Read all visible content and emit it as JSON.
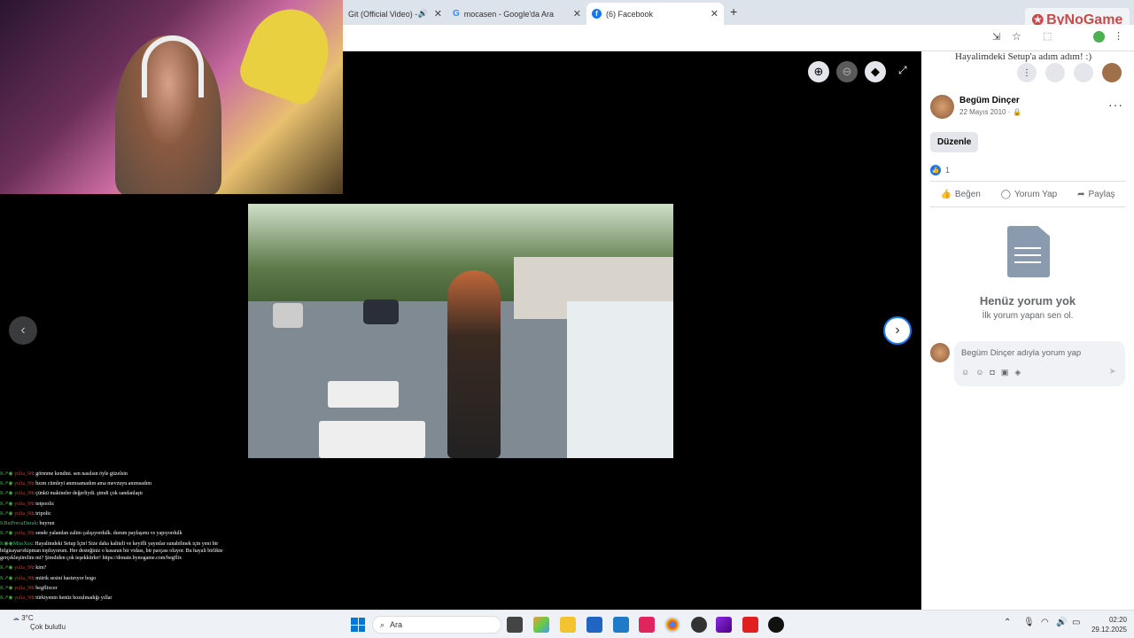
{
  "browser": {
    "tabs": [
      {
        "label": "Git (Official Video) -",
        "active": false
      },
      {
        "label": "mocasen - Google'da Ara",
        "active": false
      },
      {
        "label": "(6) Facebook",
        "active": true
      }
    ],
    "new_tab": "+"
  },
  "overlay": {
    "logo": "ByNoGame",
    "banner": "Hayalimdeki Setup'a adım adım! :)"
  },
  "post": {
    "author": "Begüm Dinçer",
    "date": "22 Mayıs 2010 ·",
    "edit_button": "Düzenle",
    "reaction_count": "1",
    "like_label": "Beğen",
    "comment_label": "Yorum Yap",
    "share_label": "Paylaş",
    "empty_title": "Henüz yorum yok",
    "empty_subtitle": "İlk yorum yapan sen ol.",
    "comment_placeholder": "Begüm Dinçer adıyla yorum yap"
  },
  "chat": [
    {
      "nick": "yulia_98",
      "msg": "görmme kendini. sen nasılsın öyle güzelsin"
    },
    {
      "nick": "yulia_98",
      "msg": "bzım cümleyi anımsamadım ama mevzuyu anımsadım"
    },
    {
      "nick": "yulia_98",
      "msg": "çünkü makineler değerliydi. şimdi çok sandanlaştı"
    },
    {
      "nick": "yulia_98",
      "msg": "teipoolic"
    },
    {
      "nick": "yulia_98",
      "msg": "tripolic"
    },
    {
      "nick": "BizPorcaDurak",
      "msg": "buyrun",
      "green": true
    },
    {
      "nick": "yulia_98",
      "msg": "sende yalandan zalim çalışıyordulk. durum paylaşımı vs yapıyordulk"
    },
    {
      "nick": "MissXsx",
      "msg": "Hayalimdeki Setup İçin! Size daha kaliteli ve keyifli yayınlar sunabilmek için yeni bir bilgisayar/ekipman topluyorum. Her desteğiniz o kasanın bir vidası, bir parçası oluyor. Bu hayali birlikte gerçekleştirelim mi? Şimdiden çok teşekkürler! https://donate.bynogame.com/begflix",
      "green": true
    },
    {
      "nick": "yulia_98",
      "msg": "kim?"
    },
    {
      "nick": "yulia_98",
      "msg": "mitrik sesini bastırıyor bogo"
    },
    {
      "nick": "yulia_98",
      "msg": "begflixcer"
    },
    {
      "nick": "yulia_98",
      "msg": "türkiyenin henüz bozulmadığı yıllar"
    }
  ],
  "taskbar": {
    "weather_temp": "3°C",
    "weather_text": "Çok bulutlu",
    "search_label": "Ara",
    "time": "02:20",
    "date": "29.12.2025"
  }
}
